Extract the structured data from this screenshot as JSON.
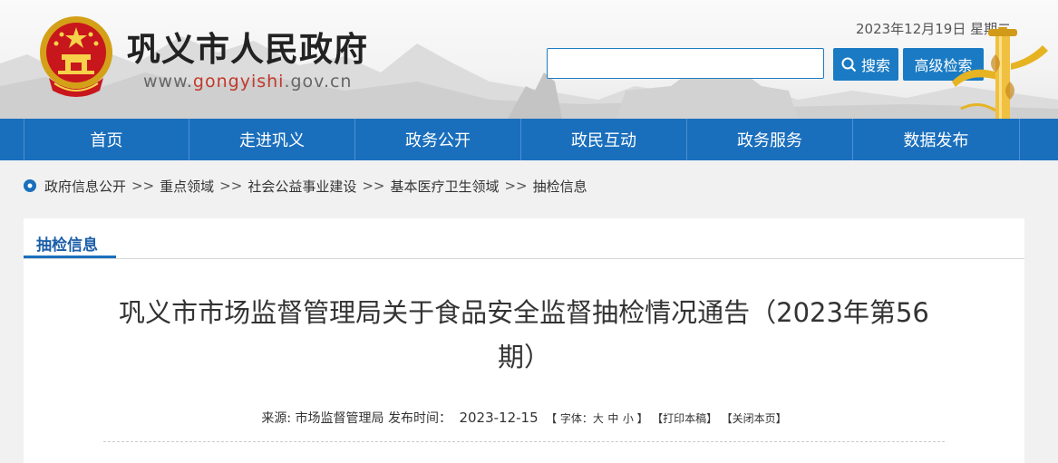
{
  "header": {
    "site_title": "巩义市人民政府",
    "site_url_prefix": "www.",
    "site_url_accent": "gongyishi",
    "site_url_suffix": ".gov.cn",
    "date_text": "2023年12月19日 星期二",
    "search_button": "搜索",
    "advanced_search_button": "高级检索",
    "accent_color": "#1a7bc4"
  },
  "nav": {
    "items": [
      "首页",
      "走进巩义",
      "政务公开",
      "政民互动",
      "政务服务",
      "数据发布"
    ]
  },
  "breadcrumb": {
    "items": [
      "政府信息公开",
      "重点领域",
      "社会公益事业建设",
      "基本医疗卫生领域",
      "抽检信息"
    ],
    "separator": ">>"
  },
  "panel": {
    "tab_label": "抽检信息"
  },
  "article": {
    "title_line1": "巩义市市场监督管理局关于食品安全监督抽检情况通告（2023年第56",
    "title_line2": "期）",
    "source_label": "来源:",
    "source_value": "市场监督管理局",
    "publish_label": "发布时间：",
    "publish_date": "2023-12-15",
    "font_size_label": "【 字体：",
    "font_large": "大",
    "font_medium": "中",
    "font_small": "小",
    "font_size_close": " 】",
    "print_label": "【打印本稿】",
    "close_label": "【关闭本页】"
  }
}
